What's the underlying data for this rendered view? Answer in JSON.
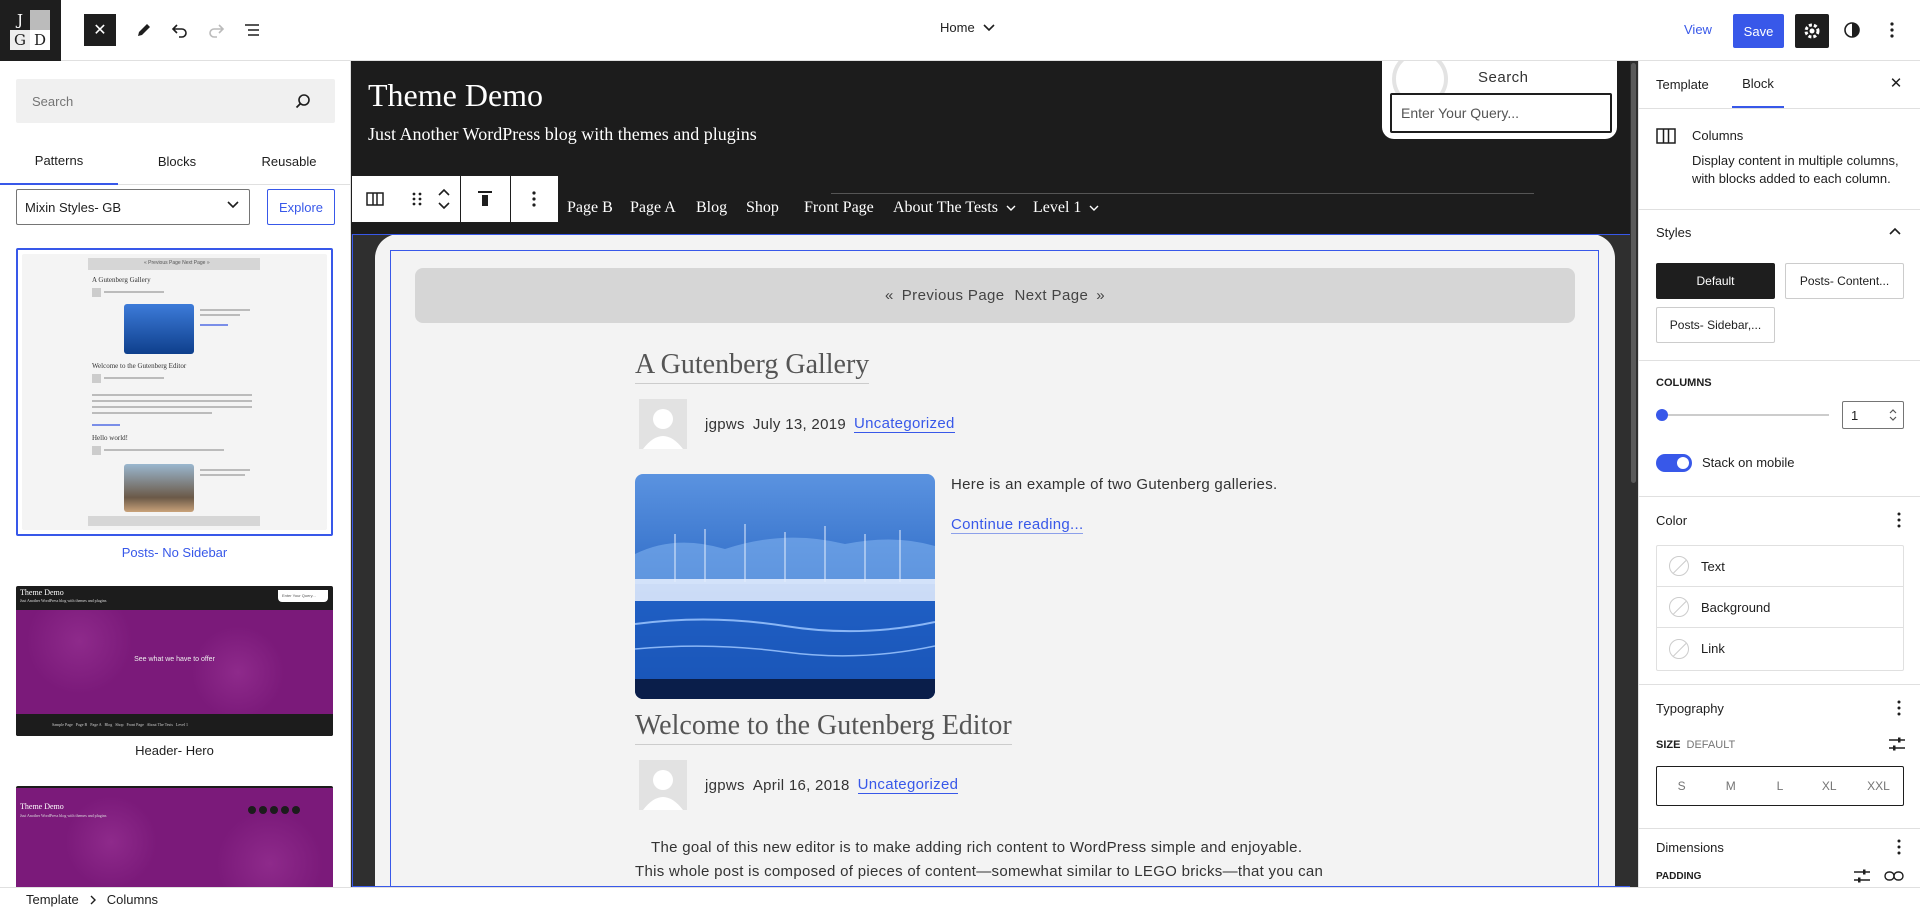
{
  "logo": {
    "letters": [
      "J",
      "G",
      "D"
    ]
  },
  "topbar": {
    "document_title": "Home",
    "view_label": "View",
    "save_label": "Save"
  },
  "inserter": {
    "search_placeholder": "Search",
    "tabs": [
      {
        "label": "Patterns",
        "active": true
      },
      {
        "label": "Blocks",
        "active": false
      },
      {
        "label": "Reusable",
        "active": false
      }
    ],
    "category_selected": "Mixin Styles- GB",
    "explore_label": "Explore",
    "patterns": [
      {
        "label": "Posts- No Sidebar",
        "selected": true
      },
      {
        "label": "Header- Hero",
        "selected": false
      },
      {
        "label": "",
        "selected": false
      }
    ],
    "thumb_text": {
      "p1": {
        "pager": "« Previous Page   Next Page »",
        "post1": "A Gutenberg Gallery",
        "post2": "Welcome to the Gutenberg Editor",
        "post3": "Hello world!"
      },
      "p2": {
        "site_title": "Theme Demo",
        "tagline": "Just Another WordPress blog with themes and plugins",
        "search_placeholder": "Enter Your Query...",
        "hero": "See what we have to offer",
        "nav": "Sample Page   Page B   Page A   Blog   Shop   Front Page   About The Tests   Level 1"
      },
      "p3": {
        "site_title": "Theme Demo",
        "tagline": "Just Another WordPress blog with themes and plugins"
      }
    }
  },
  "canvas": {
    "site_title": "Theme Demo",
    "site_tagline": "Just Another WordPress blog with themes and plugins",
    "search_label": "Search",
    "search_placeholder": "Enter Your Query...",
    "nav": [
      "Page B",
      "Page A",
      "Blog",
      "Shop",
      "Front Page",
      "About The Tests",
      "Level 1"
    ],
    "pager": {
      "prev": "Previous Page",
      "next": "Next Page"
    },
    "posts": [
      {
        "title": "A Gutenberg Gallery",
        "author": "jgpws",
        "date": "July 13, 2019",
        "category": "Uncategorized",
        "excerpt": "Here is an example of two Gutenberg galleries.",
        "continue": "Continue reading..."
      },
      {
        "title": "Welcome to the Gutenberg Editor",
        "author": "jgpws",
        "date": "April 16, 2018",
        "category": "Uncategorized",
        "body_line1": "The goal of this new editor is to make adding rich content to WordPress simple and enjoyable.",
        "body_line2": "This whole post is composed of pieces of content—somewhat similar to LEGO bricks—that you can"
      }
    ]
  },
  "sidebar": {
    "tabs": [
      {
        "label": "Template",
        "active": false
      },
      {
        "label": "Block",
        "active": true
      }
    ],
    "block": {
      "name": "Columns",
      "description": "Display content in multiple columns, with blocks added to each column."
    },
    "styles": {
      "heading": "Styles",
      "options": [
        {
          "label": "Default",
          "active": true
        },
        {
          "label": "Posts- Content...",
          "active": false
        },
        {
          "label": "Posts- Sidebar,...",
          "active": false
        }
      ]
    },
    "columns": {
      "label": "COLUMNS",
      "value": "1",
      "slider_fraction": 0
    },
    "stack_on_mobile": {
      "label": "Stack on mobile",
      "enabled": true
    },
    "color": {
      "heading": "Color",
      "items": [
        "Text",
        "Background",
        "Link"
      ]
    },
    "typography": {
      "heading": "Typography",
      "size_label": "SIZE",
      "size_value": "DEFAULT",
      "sizes": [
        "S",
        "M",
        "L",
        "XL",
        "XXL"
      ]
    },
    "dimensions": {
      "heading": "Dimensions",
      "padding_label": "PADDING"
    }
  },
  "breadcrumb": [
    "Template",
    "Columns"
  ],
  "colors": {
    "accent": "#3858e9",
    "dark": "#1e1e1e",
    "header_bg": "#1c1c1c",
    "card_bg": "#f3f3f3",
    "purple": "#7b1a7a"
  }
}
